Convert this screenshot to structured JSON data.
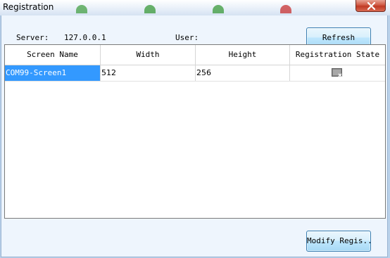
{
  "window": {
    "title": "Registration"
  },
  "colors": {
    "title_dots": [
      "#46a046",
      "#3a9a3a",
      "#3a9a3a",
      "#c83232"
    ],
    "selection": "#3399ff"
  },
  "server": {
    "label": "Server:",
    "value": "127.0.0.1"
  },
  "user": {
    "label": "User:",
    "value": ""
  },
  "buttons": {
    "refresh": "Refresh",
    "modify": "Modify Regis..."
  },
  "table": {
    "columns": [
      "Screen Name",
      "Width",
      "Height",
      "Registration State"
    ],
    "rows": [
      {
        "screen_name": "COM99-Screen1",
        "width": "512",
        "height": "256",
        "registration_state_icon": "unregistered-screen-icon"
      }
    ]
  }
}
